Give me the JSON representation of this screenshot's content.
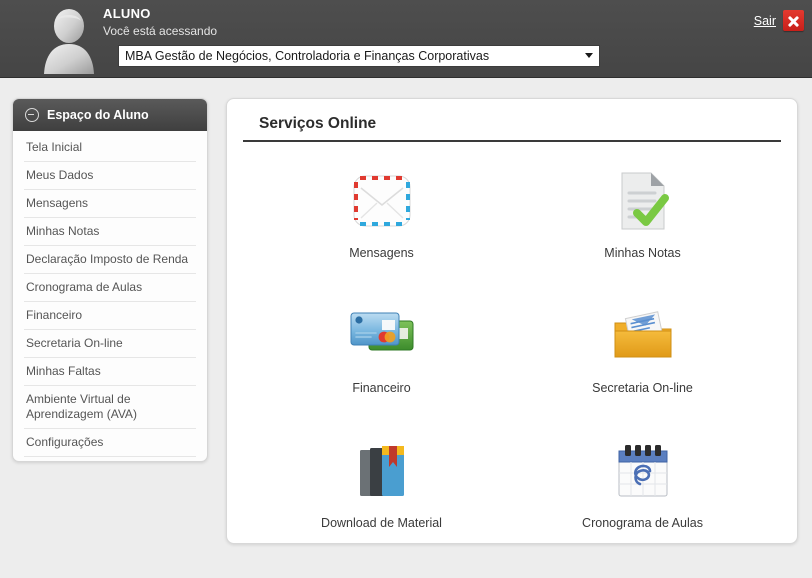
{
  "header": {
    "user_name": "ALUNO",
    "user_subtitle": "Você está acessando",
    "course_selected": "MBA Gestão de Negócios, Controladoria e Finanças Corporativas",
    "logout_label": "Sair",
    "close_label": "×",
    "avatar_icon": "user-silhouette-icon",
    "bar_color": "#4a4a4a",
    "close_button_color": "#d92b24"
  },
  "sidebar": {
    "title": "Espaço do Aluno",
    "collapse_icon": "circle-minus-icon",
    "items": [
      {
        "label": "Tela Inicial"
      },
      {
        "label": "Meus Dados"
      },
      {
        "label": "Mensagens"
      },
      {
        "label": "Minhas Notas"
      },
      {
        "label": "Declaração Imposto de Renda"
      },
      {
        "label": "Cronograma de Aulas"
      },
      {
        "label": "Financeiro"
      },
      {
        "label": "Secretaria On-line"
      },
      {
        "label": "Minhas Faltas"
      },
      {
        "label": "Ambiente Virtual de Aprendizagem (AVA)"
      },
      {
        "label": "Configurações"
      }
    ]
  },
  "main": {
    "title": "Serviços Online",
    "services": [
      {
        "label": "Mensagens",
        "icon": "envelope-airmail-icon"
      },
      {
        "label": "Minhas Notas",
        "icon": "document-check-icon"
      },
      {
        "label": "Financeiro",
        "icon": "credit-cards-icon"
      },
      {
        "label": "Secretaria On-line",
        "icon": "folder-documents-icon"
      },
      {
        "label": "Download de Material",
        "icon": "books-icon"
      },
      {
        "label": "Cronograma de Aulas",
        "icon": "calendar-icon"
      }
    ]
  }
}
